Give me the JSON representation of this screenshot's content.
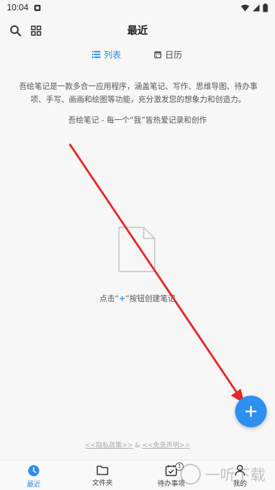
{
  "statusbar": {
    "time": "10:04"
  },
  "header": {
    "title": "最近"
  },
  "tabs": [
    {
      "label": "列表",
      "active": true
    },
    {
      "label": "日历",
      "active": false
    }
  ],
  "intro": {
    "text": "吾绘笔记是一款多合一应用程序，涵盖笔记、写作、思维导图、待办事项、手写、画画和绘图等功能，充分激发您的想象力和创造力。",
    "slogan": "吾绘笔记 - 每一个“我”皆热爱记录和创作"
  },
  "empty": {
    "hint_before": "点击“",
    "hint_plus": "+",
    "hint_after": "”按钮创建笔记"
  },
  "legal": {
    "privacy": "<<隐私政策>>",
    "sep": "&",
    "disclaimer": "<<免责声明>>"
  },
  "nav": [
    {
      "label": "最近",
      "icon": "clock-icon",
      "active": true
    },
    {
      "label": "文件夹",
      "icon": "folder-icon",
      "active": false
    },
    {
      "label": "待办事项",
      "icon": "calendar-check-icon",
      "active": false,
      "badge": "1"
    },
    {
      "label": "我的",
      "icon": "person-icon",
      "active": false
    }
  ],
  "watermark": {
    "text": "一听下载"
  },
  "colors": {
    "accent": "#2f8cf0",
    "arrow": "#e8272b",
    "background": "#f7f7f7"
  }
}
